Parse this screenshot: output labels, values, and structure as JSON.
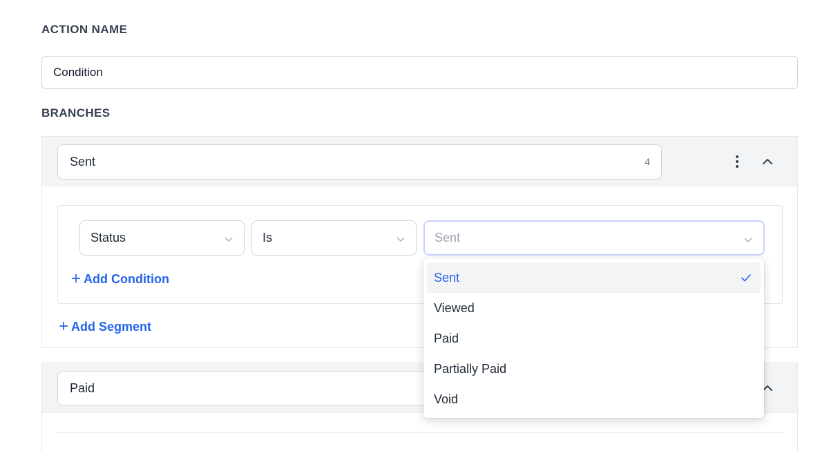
{
  "form": {
    "action_name_label": "ACTION NAME",
    "action_name_value": "Condition",
    "branches_label": "BRANCHES"
  },
  "branches": [
    {
      "name": "Sent",
      "char_count": "4",
      "segment": {
        "field": "Status",
        "operator": "Is",
        "value_placeholder": "Sent",
        "add_condition_label": "Add Condition"
      },
      "add_segment_label": "Add Segment"
    },
    {
      "name": "Paid"
    }
  ],
  "dropdown": {
    "options": [
      {
        "label": "Sent",
        "selected": true
      },
      {
        "label": "Viewed",
        "selected": false
      },
      {
        "label": "Paid",
        "selected": false
      },
      {
        "label": "Partially Paid",
        "selected": false
      },
      {
        "label": "Void",
        "selected": false
      }
    ]
  },
  "colors": {
    "accent": "#2563eb",
    "header_bg": "#f3f4f6",
    "border": "#d1d5db",
    "focus_ring": "#c7d2fe"
  },
  "icons": {
    "more": "kebab-menu-icon",
    "collapse": "chevron-up-icon",
    "select": "chevron-down-icon",
    "add": "plus-icon",
    "selected": "check-icon"
  }
}
